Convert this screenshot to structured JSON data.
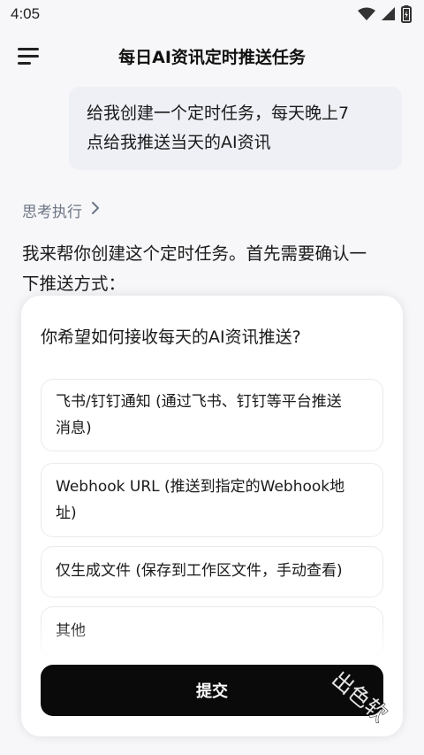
{
  "status_bar": {
    "time": "4:05",
    "icons": [
      "wifi-icon",
      "signal-icon",
      "battery-icon"
    ]
  },
  "header": {
    "menu_icon": "hamburger-menu-icon",
    "title": "每日AI资讯定时推送任务"
  },
  "chat": {
    "user_message": {
      "line1": "给我创建一个定时任务，每天晚上7",
      "line2": "点给我推送当天的AI资讯"
    },
    "thinking": {
      "label": "思考执行",
      "icon": "chevron-right-icon"
    },
    "assistant_message": {
      "line1": "我来帮你创建这个定时任务。首先需要确认一",
      "line2": "下推送方式："
    }
  },
  "question_card": {
    "question": "你希望如何接收每天的AI资讯推送?",
    "options": [
      {
        "line1": "飞书/钉钉通知 (通过飞书、钉钉等平台推送",
        "line2": "消息)"
      },
      {
        "line1": "Webhook URL (推送到指定的Webhook地",
        "line2": "址)"
      },
      {
        "line1": "仅生成文件 (保存到工作区文件，手动查看)",
        "line2": ""
      },
      {
        "line1": "其他",
        "line2": ""
      }
    ],
    "submit_label": "提交"
  },
  "watermark": "出色软",
  "colors": {
    "background": "#f7f7f9",
    "user_bubble": "#eef0f5",
    "card": "#ffffff",
    "submit_button": "#0a0a0a",
    "muted_text": "#6e7585"
  }
}
